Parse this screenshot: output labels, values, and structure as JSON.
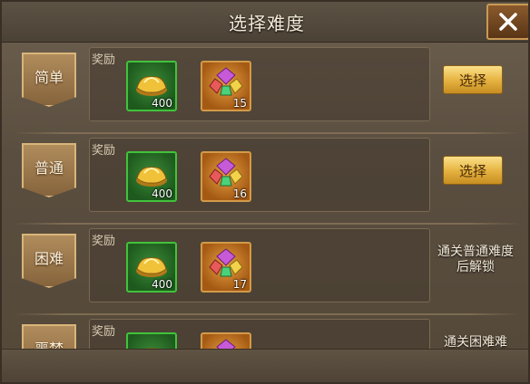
{
  "dialog": {
    "title": "选择难度",
    "reward_label": "奖励",
    "select_label": "选择"
  },
  "rows": [
    {
      "difficulty": "简单",
      "rewards": [
        "400",
        "15"
      ],
      "action": "select"
    },
    {
      "difficulty": "普通",
      "rewards": [
        "400",
        "16"
      ],
      "action": "select"
    },
    {
      "difficulty": "困难",
      "rewards": [
        "400",
        "17"
      ],
      "lock_text": "通关普通难度后解锁"
    },
    {
      "difficulty": "噩梦",
      "lock_text": "通关困难难"
    }
  ],
  "colors": {
    "green_item_border": "#42c23c",
    "orange_item_bg": "#e8a040",
    "select_button": "#e7b544"
  },
  "icons": [
    "close-icon",
    "gold-ingot-icon",
    "gem-cluster-icon"
  ]
}
